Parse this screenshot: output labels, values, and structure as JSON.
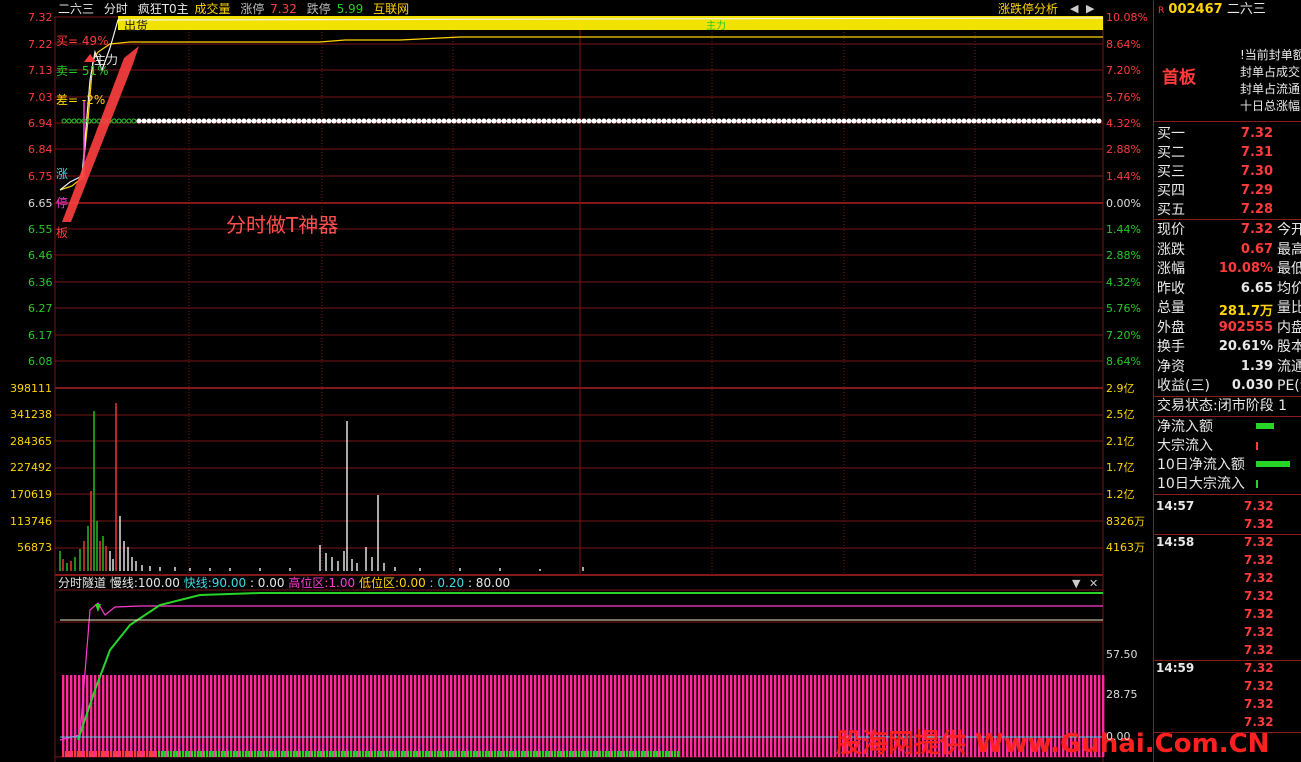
{
  "header": {
    "stock_name": "二六三",
    "view": "分时",
    "indicator": "疯狂T0主",
    "volume_label": "成交量",
    "limit_up_label": "涨停",
    "limit_up_value": "7.32",
    "limit_down_label": "跌停",
    "limit_down_value": "5.99",
    "sector": "互联网",
    "analysis_button": "涨跌停分析"
  },
  "price_axis": [
    "7.32",
    "7.22",
    "7.13",
    "7.03",
    "6.94",
    "6.84",
    "6.75",
    "6.65",
    "6.55",
    "6.46",
    "6.36",
    "6.27",
    "6.17",
    "6.08"
  ],
  "pct_axis": [
    "10.08%",
    "8.64%",
    "7.20%",
    "5.76%",
    "4.32%",
    "2.88%",
    "1.44%",
    "0.00%",
    "1.44%",
    "2.88%",
    "4.32%",
    "5.76%",
    "7.20%",
    "8.64%"
  ],
  "volume_axis_left": [
    "398111",
    "341238",
    "284365",
    "227492",
    "170619",
    "113746",
    "56873"
  ],
  "volume_axis_right": [
    "2.9亿",
    "2.5亿",
    "2.1亿",
    "1.7亿",
    "1.2亿",
    "8326万",
    "4163万"
  ],
  "annotations": {
    "buy": "买= 49%",
    "sell": "卖= 51%",
    "diff": "差= -2%",
    "main": "主力",
    "exit": "出货",
    "zhang": "涨",
    "ting": "停",
    "ban": "板",
    "promo": "分时做T神器",
    "small_green": "主力"
  },
  "sub_indicator": {
    "name": "分时隧道",
    "slow_label": "慢线:",
    "slow_value": "100.00",
    "fast_label": "快线:",
    "fast_value": "90.00",
    "v1": ": 0.00",
    "high_label": "高位区:",
    "high_value": "1.00",
    "low_label": "低位区:",
    "low_value": "0.00",
    "v2": ": 0.20",
    "v3": ": 80.00",
    "axis": [
      "57.50",
      "28.75",
      "0.00"
    ]
  },
  "right_panel": {
    "marker": "R",
    "code": "002467",
    "name": "二六三",
    "board": "首板",
    "seal_lines": [
      "当前封单额",
      "封单占成交",
      "封单占流通",
      "十日总涨幅"
    ],
    "bids": [
      {
        "label": "买一",
        "price": "7.32"
      },
      {
        "label": "买二",
        "price": "7.31"
      },
      {
        "label": "买三",
        "price": "7.30"
      },
      {
        "label": "买四",
        "price": "7.29"
      },
      {
        "label": "买五",
        "price": "7.28"
      }
    ],
    "quote": [
      {
        "label": "现价",
        "value": "7.32",
        "extra": "今开"
      },
      {
        "label": "涨跌",
        "value": "0.67",
        "extra": "最高"
      },
      {
        "label": "涨幅",
        "value": "10.08%",
        "extra": "最低"
      },
      {
        "label": "昨收",
        "value": "6.65",
        "extra": "均价"
      },
      {
        "label": "总量",
        "value": "281.7万",
        "extra": "量比"
      },
      {
        "label": "外盘",
        "value": "902555",
        "extra": "内盘"
      },
      {
        "label": "换手",
        "value": "20.61%",
        "extra": "股本"
      },
      {
        "label": "净资",
        "value": "1.39",
        "extra": "流通"
      },
      {
        "label": "收益(三)",
        "value": "0.030",
        "extra": "PE(动"
      }
    ],
    "status_label": "交易状态:",
    "status_value": "闭市阶段",
    "status_extra": "1",
    "flows": [
      "净流入额",
      "大宗流入",
      "10日净流入额",
      "10日大宗流入"
    ],
    "ticks": [
      {
        "time": "14:57",
        "prices": [
          "7.32",
          "7.32"
        ]
      },
      {
        "time": "14:58",
        "prices": [
          "7.32",
          "7.32",
          "7.32",
          "7.32",
          "7.32",
          "7.32",
          "7.32"
        ]
      },
      {
        "time": "14:59",
        "prices": [
          "7.32",
          "7.32",
          "7.32",
          "7.32"
        ]
      }
    ]
  },
  "watermark": "股海网提供 Www.Guhai.Com.CN",
  "colors": {
    "up": "#ff3b3b",
    "down": "#29c929",
    "grid": "#8b1a1a",
    "yellow": "#ffd400",
    "magenta": "#ff3bd3"
  }
}
